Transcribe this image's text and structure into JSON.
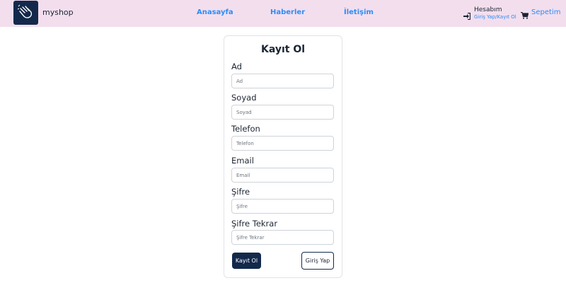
{
  "navbar": {
    "brand": "myshop",
    "links": [
      "Anasayfa",
      "Haberler",
      "İletişim"
    ],
    "account_title": "Hesabım",
    "account_sub": "Giriş Yap/Kayıt Ol",
    "cart_label": "Sepetim"
  },
  "form": {
    "title": "Kayıt Ol",
    "fields": [
      {
        "label": "Ad",
        "placeholder": "Ad"
      },
      {
        "label": "Soyad",
        "placeholder": "Soyad"
      },
      {
        "label": "Telefon",
        "placeholder": "Telefon"
      },
      {
        "label": "Email",
        "placeholder": "Email"
      },
      {
        "label": "Şifre",
        "placeholder": "Şifre"
      },
      {
        "label": "Şifre Tekrar",
        "placeholder": "Şifre Tekrar"
      }
    ],
    "submit_label": "Kayıt Ol",
    "login_label": "Giriş Yap"
  },
  "icons": {
    "logo": "hand-logo-icon",
    "account": "sign-in-icon",
    "cart": "cart-icon"
  },
  "colors": {
    "navbar_bg": "#f3deee",
    "brand_dark": "#13294b",
    "link_blue": "#2d8df3"
  }
}
